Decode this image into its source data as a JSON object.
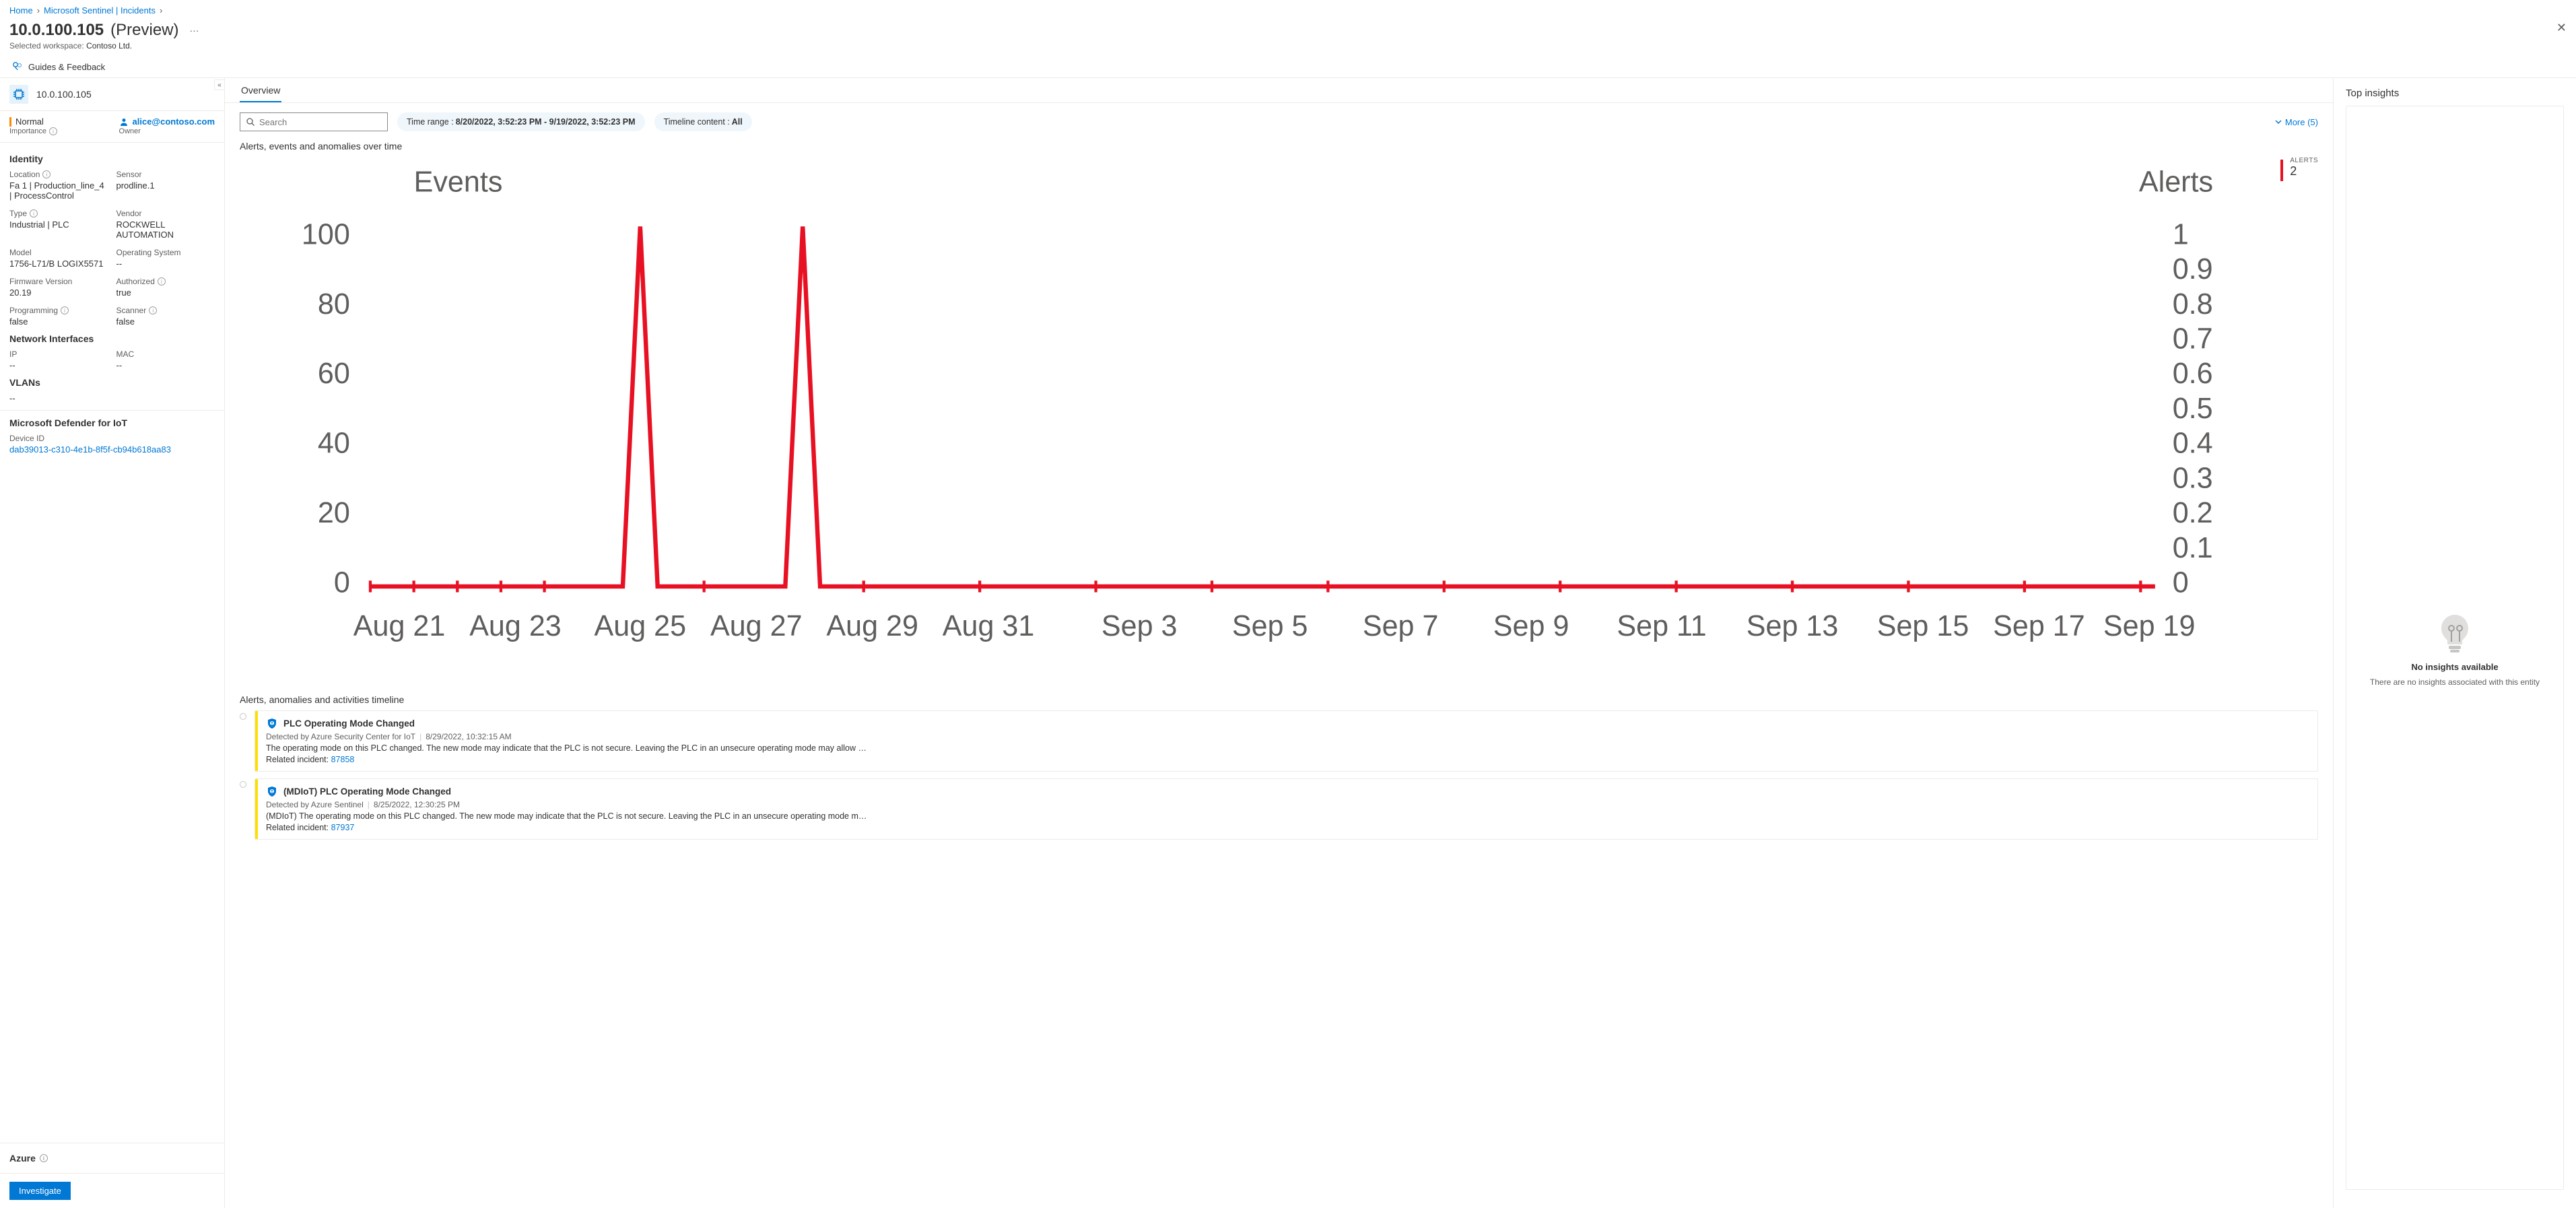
{
  "breadcrumb": {
    "home": "Home",
    "sentinel": "Microsoft Sentinel | Incidents"
  },
  "page": {
    "title": "10.0.100.105",
    "suffix": "(Preview)",
    "workspace_label": "Selected workspace:",
    "workspace": "Contoso Ltd."
  },
  "toolbar": {
    "guides": "Guides & Feedback"
  },
  "entity": {
    "title": "10.0.100.105"
  },
  "status": {
    "severity": "Normal",
    "importance": "Importance",
    "owner_label": "Owner",
    "owner": "alice@contoso.com"
  },
  "identity": {
    "heading": "Identity",
    "location_l": "Location",
    "location_v": "Fa 1 | Production_line_4 | ProcessControl",
    "sensor_l": "Sensor",
    "sensor_v": "prodline.1",
    "type_l": "Type",
    "type_v": "Industrial | PLC",
    "vendor_l": "Vendor",
    "vendor_v": "ROCKWELL AUTOMATION",
    "model_l": "Model",
    "model_v": "1756-L71/B LOGIX5571",
    "os_l": "Operating System",
    "os_v": "--",
    "fw_l": "Firmware Version",
    "fw_v": "20.19",
    "auth_l": "Authorized",
    "auth_v": "true",
    "prog_l": "Programming",
    "prog_v": "false",
    "scan_l": "Scanner",
    "scan_v": "false"
  },
  "net": {
    "heading": "Network Interfaces",
    "ip_l": "IP",
    "ip_v": "--",
    "mac_l": "MAC",
    "mac_v": "--"
  },
  "vlans": {
    "heading": "VLANs",
    "value": "--"
  },
  "mdiot": {
    "heading": "Microsoft Defender for IoT",
    "device_l": "Device ID",
    "device_v": "dab39013-c310-4e1b-8f5f-cb94b618aa83"
  },
  "azure": {
    "heading": "Azure"
  },
  "investigate": "Investigate",
  "overview": {
    "tab": "Overview",
    "search_ph": "Search",
    "time_label": "Time range :",
    "time_val": "8/20/2022, 3:52:23 PM - 9/19/2022, 3:52:23 PM",
    "content_label": "Timeline content :",
    "content_val": "All",
    "more": "More (5)"
  },
  "chart": {
    "title": "Alerts, events and anomalies over time",
    "events_l": "Events",
    "alerts_l": "Alerts",
    "side_l": "ALERTS",
    "side_v": "2"
  },
  "timeline": {
    "heading": "Alerts, anomalies and activities timeline",
    "items": [
      {
        "title": "PLC Operating Mode Changed",
        "source": "Detected by Azure Security Center for IoT",
        "time": "8/29/2022, 10:32:15 AM",
        "desc": "The operating mode on this PLC changed. The new mode may indicate that the PLC is not secure. Leaving the PLC in an unsecure operating mode may allow …",
        "rel_l": "Related incident:",
        "rel_v": "87858"
      },
      {
        "title": "(MDIoT) PLC Operating Mode Changed",
        "source": "Detected by Azure Sentinel",
        "time": "8/25/2022, 12:30:25 PM",
        "desc": "(MDIoT) The operating mode on this PLC changed. The new mode may indicate that the PLC is not secure. Leaving the PLC in an unsecure operating mode m…",
        "rel_l": "Related incident:",
        "rel_v": "87937"
      }
    ]
  },
  "insights": {
    "heading": "Top insights",
    "none_t": "No insights available",
    "none_s": "There are no insights associated with this entity"
  },
  "chart_data": {
    "type": "line",
    "title": "Alerts, events and anomalies over time",
    "left_axis": {
      "label": "Events",
      "ticks": [
        0,
        20,
        40,
        60,
        80,
        100
      ],
      "ylim": [
        0,
        110
      ]
    },
    "right_axis": {
      "label": "Alerts",
      "ticks": [
        0,
        0.1,
        0.2,
        0.3,
        0.4,
        0.5,
        0.6,
        0.7,
        0.8,
        0.9,
        1
      ],
      "ylim": [
        0,
        1
      ]
    },
    "categories": [
      "Aug 21",
      "Aug 23",
      "Aug 25",
      "Aug 27",
      "Aug 29",
      "Aug 31",
      "Sep 3",
      "Sep 5",
      "Sep 7",
      "Sep 9",
      "Sep 11",
      "Sep 13",
      "Sep 15",
      "Sep 17",
      "Sep 19"
    ],
    "series": [
      {
        "name": "Events",
        "axis": "left",
        "values": [
          0,
          0,
          105,
          0,
          105,
          0,
          0,
          0,
          0,
          0,
          0,
          0,
          0,
          0,
          0
        ]
      }
    ],
    "alerts_total": 2
  }
}
